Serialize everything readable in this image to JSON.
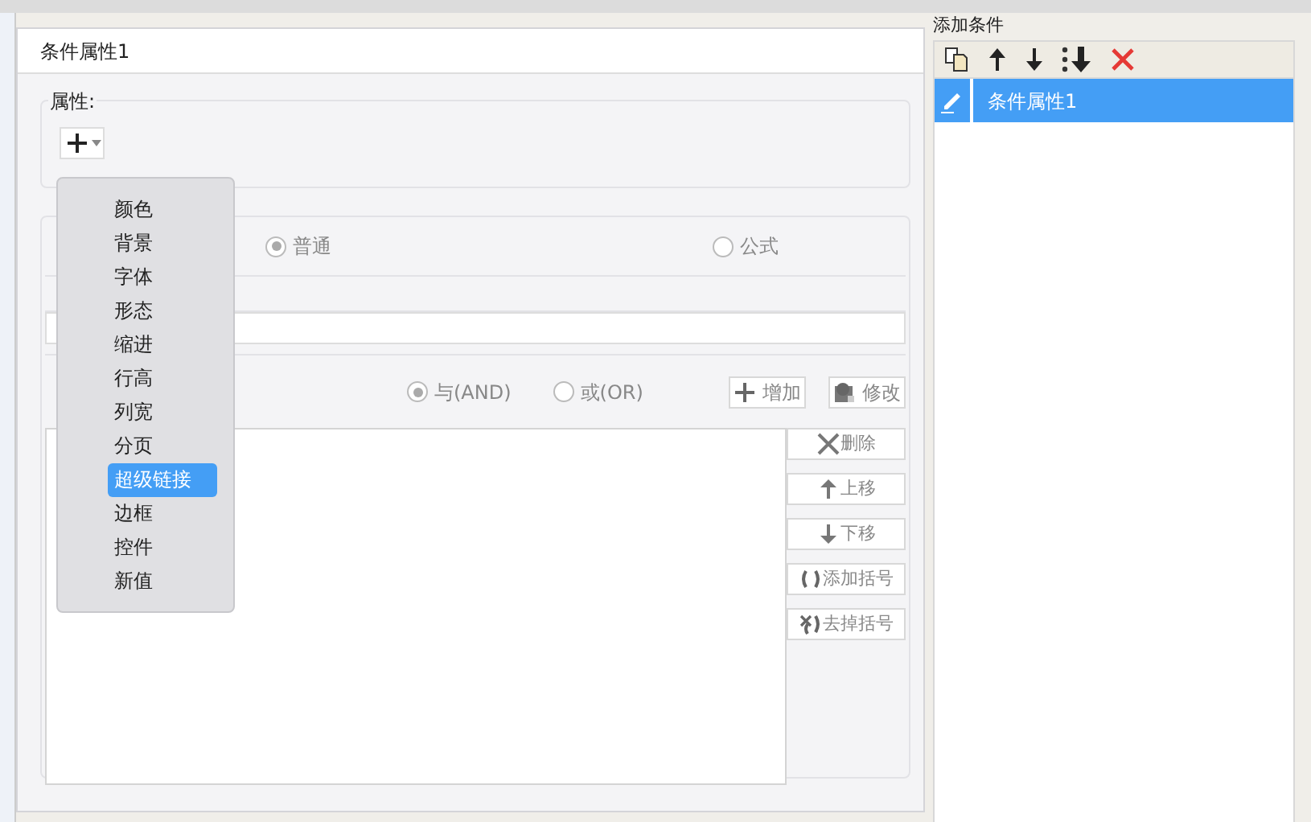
{
  "dialog": {
    "title": "条件属性1",
    "attributes": {
      "legend": "属性:"
    },
    "menu": {
      "items": [
        {
          "label": "颜色",
          "selected": false
        },
        {
          "label": "背景",
          "selected": false
        },
        {
          "label": "字体",
          "selected": false
        },
        {
          "label": "形态",
          "selected": false
        },
        {
          "label": "缩进",
          "selected": false
        },
        {
          "label": "行高",
          "selected": false
        },
        {
          "label": "列宽",
          "selected": false
        },
        {
          "label": "分页",
          "selected": false
        },
        {
          "label": "超级链接",
          "selected": true
        },
        {
          "label": "边框",
          "selected": false
        },
        {
          "label": "控件",
          "selected": false
        },
        {
          "label": "新值",
          "selected": false
        }
      ]
    },
    "type_options": [
      {
        "label": "普通",
        "selected": true
      },
      {
        "label": "公式",
        "selected": false
      }
    ],
    "logic_options": [
      {
        "label": "与(AND)",
        "selected": true
      },
      {
        "label": "或(OR)",
        "selected": false
      }
    ],
    "top_buttons": [
      {
        "label": "增加",
        "kind": "plus"
      },
      {
        "label": "修改",
        "kind": "gear"
      }
    ],
    "side_buttons": [
      {
        "label": "删除",
        "kind": "cross"
      },
      {
        "label": "上移",
        "kind": "up"
      },
      {
        "label": "下移",
        "kind": "down"
      },
      {
        "label": "添加括号",
        "kind": "paren"
      },
      {
        "label": "去掉括号",
        "kind": "unparen"
      }
    ]
  },
  "right_panel": {
    "header": "添加条件",
    "items": [
      {
        "label": "条件属性1",
        "selected": true
      }
    ]
  }
}
